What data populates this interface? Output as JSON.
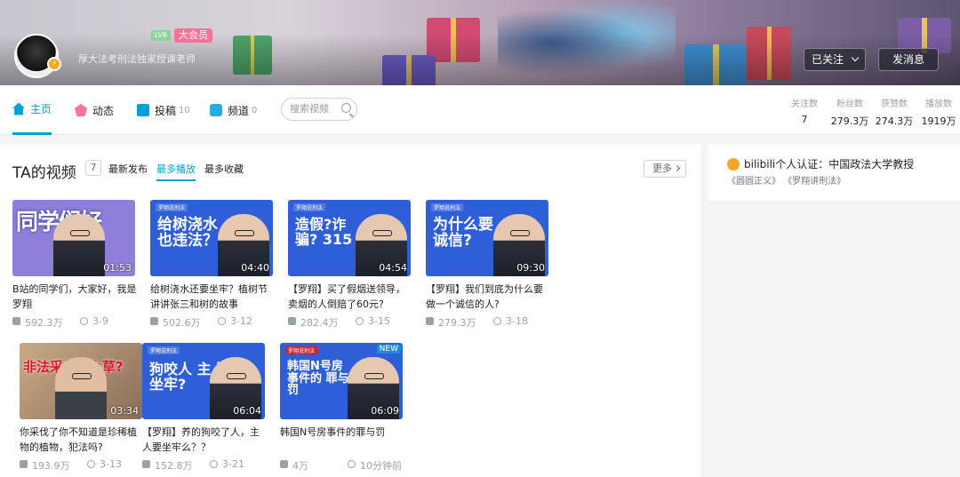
{
  "header": {
    "level": "LV6",
    "vip": "大会员",
    "sign": "厚大法考刑法独家授课老师",
    "follow_label": "已关注",
    "message_label": "发消息"
  },
  "nav": {
    "home": "主页",
    "dynamic": "动态",
    "posts": "投稿",
    "posts_count": "10",
    "channels": "频道",
    "channels_count": "0",
    "search_placeholder": "搜索视频"
  },
  "stats": [
    {
      "label": "关注数",
      "value": "7"
    },
    {
      "label": "粉丝数",
      "value": "279.3万"
    },
    {
      "label": "获赞数",
      "value": "274.3万"
    },
    {
      "label": "播放数",
      "value": "1919万"
    }
  ],
  "videos_section": {
    "title": "TA的视频",
    "count": "7",
    "sort_options": [
      "最新发布",
      "最多播放",
      "最多收藏"
    ],
    "active_sort": "最多播放",
    "more_label": "更多"
  },
  "videos": [
    {
      "thumb_text": "同学们好",
      "duration": "01:53",
      "title": "B站的同学们，大家好，我是罗翔",
      "plays": "592.3万",
      "date": "3-9"
    },
    {
      "thumb_text": "给树浇水也违法？",
      "duration": "04:40",
      "title": "给树浇水还要坐牢？植树节讲讲张三和树的故事",
      "plays": "502.6万",
      "date": "3-12"
    },
    {
      "thumb_text": "造假?诈骗? 315",
      "duration": "04:54",
      "title": "【罗翔】买了假烟送领导，卖烟的人倒赔了60元?",
      "plays": "282.4万",
      "date": "3-15"
    },
    {
      "thumb_text": "为什么要诚信?",
      "duration": "09:30",
      "title": "【罗翔】我们到底为什么要做一个诚信的人?",
      "plays": "279.3万",
      "date": "3-18"
    },
    {
      "thumb_text": "非法采伐? 小草?",
      "duration": "03:34",
      "title": "你采伐了你不知道是珍稀植物的植物，犯法吗?",
      "plays": "193.9万",
      "date": "3-13"
    },
    {
      "thumb_text": "狗咬人 主人坐牢?",
      "duration": "06:04",
      "title": "【罗翔】养的狗咬了人，主人要坐牢么？？",
      "plays": "152.8万",
      "date": "3-21"
    },
    {
      "thumb_text": "韩国N号房事件的 罪与罚",
      "duration": "06:09",
      "title": "韩国N号房事件的罪与罚",
      "plays": "4万",
      "date": "10分钟前",
      "badge": "NEW"
    }
  ],
  "side": {
    "cert": "bilibili个人认证：中国政法大学教授",
    "tags": "《圆圆正义》 《罗翔讲刑法》"
  },
  "colors": {
    "accent": "#00a1d6",
    "pink": "#fb7299",
    "thumb_blue": "#2f5fd8"
  }
}
